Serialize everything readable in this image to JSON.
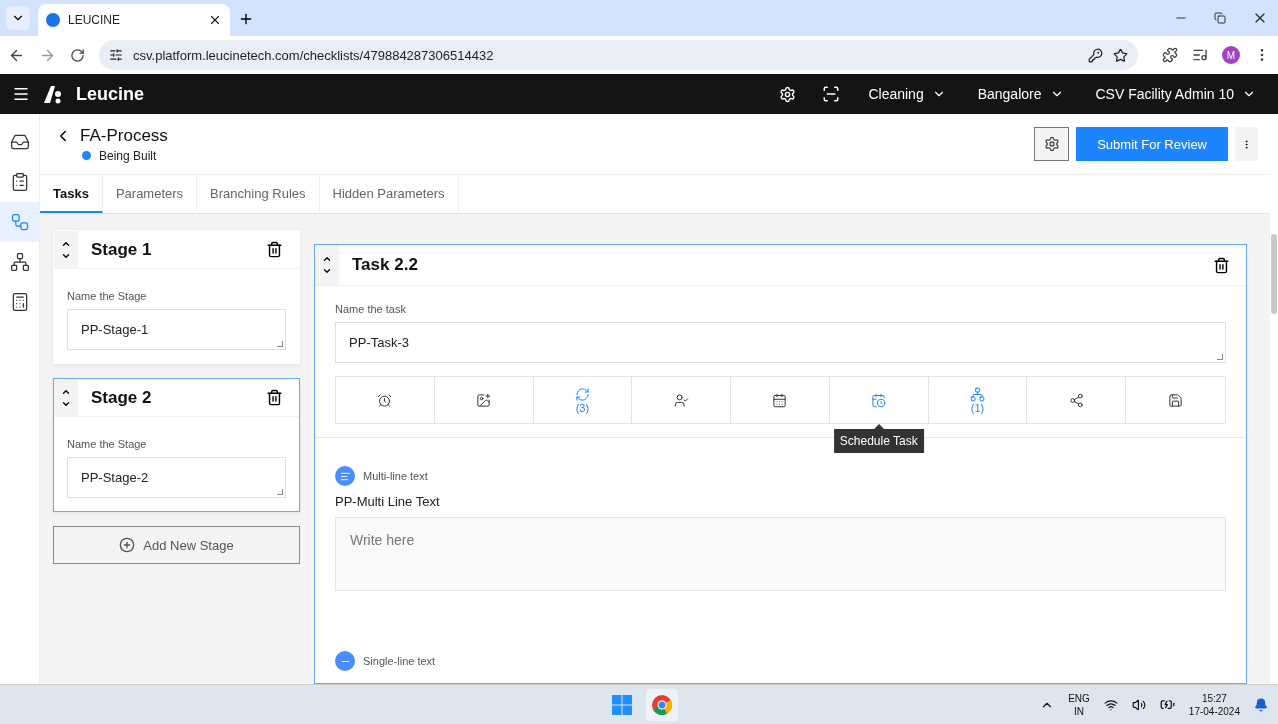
{
  "browser": {
    "tab_title": "LEUCINE",
    "url": "csv.platform.leucinetech.com/checklists/479884287306514432",
    "profile": "M"
  },
  "app_header": {
    "brand": "Leucine",
    "dropdowns": [
      "Cleaning",
      "Bangalore",
      "CSV Facility Admin 10"
    ]
  },
  "sidebar": {
    "items": [
      {
        "kind": "inbox",
        "selected": false
      },
      {
        "kind": "checklist",
        "selected": false
      },
      {
        "kind": "flow",
        "selected": true
      },
      {
        "kind": "hierarchy",
        "selected": false
      },
      {
        "kind": "report",
        "selected": false
      }
    ]
  },
  "process": {
    "title": "FA-Process",
    "status": "Being Built",
    "submit": "Submit For Review"
  },
  "tabs": [
    {
      "label": "Tasks",
      "selected": true
    },
    {
      "label": "Parameters",
      "selected": false
    },
    {
      "label": "Branching Rules",
      "selected": false
    },
    {
      "label": "Hidden Parameters",
      "selected": false
    }
  ],
  "stages": [
    {
      "title": "Stage 1",
      "field_label": "Name the Stage",
      "value": "PP-Stage-1",
      "selected": false
    },
    {
      "title": "Stage 2",
      "field_label": "Name the Stage",
      "value": "PP-Stage-2",
      "selected": true
    }
  ],
  "add_stage": "Add New Stage",
  "task": {
    "title": "Task 2.2",
    "field_label": "Name the task",
    "value": "PP-Task-3",
    "tools": [
      {
        "kind": "timer",
        "active": false
      },
      {
        "kind": "media",
        "active": false
      },
      {
        "kind": "recurrence",
        "active": true,
        "count": "(3)"
      },
      {
        "kind": "assignee",
        "active": false
      },
      {
        "kind": "reschedule",
        "active": false
      },
      {
        "kind": "schedule",
        "active": true,
        "tooltip": "Schedule Task"
      },
      {
        "kind": "hierarchy",
        "active": true,
        "count": "(1)"
      },
      {
        "kind": "flow",
        "active": false
      },
      {
        "kind": "lock",
        "active": false
      }
    ]
  },
  "parameters": [
    {
      "kind": "multi",
      "type_label": "Multi-line text",
      "label": "PP-Multi Line Text",
      "placeholder": "Write here"
    },
    {
      "kind": "single",
      "type_label": "Single-line text"
    }
  ],
  "taskbar": {
    "language": "ENG",
    "region": "IN",
    "time": "15:27",
    "date": "17-04-2024"
  }
}
